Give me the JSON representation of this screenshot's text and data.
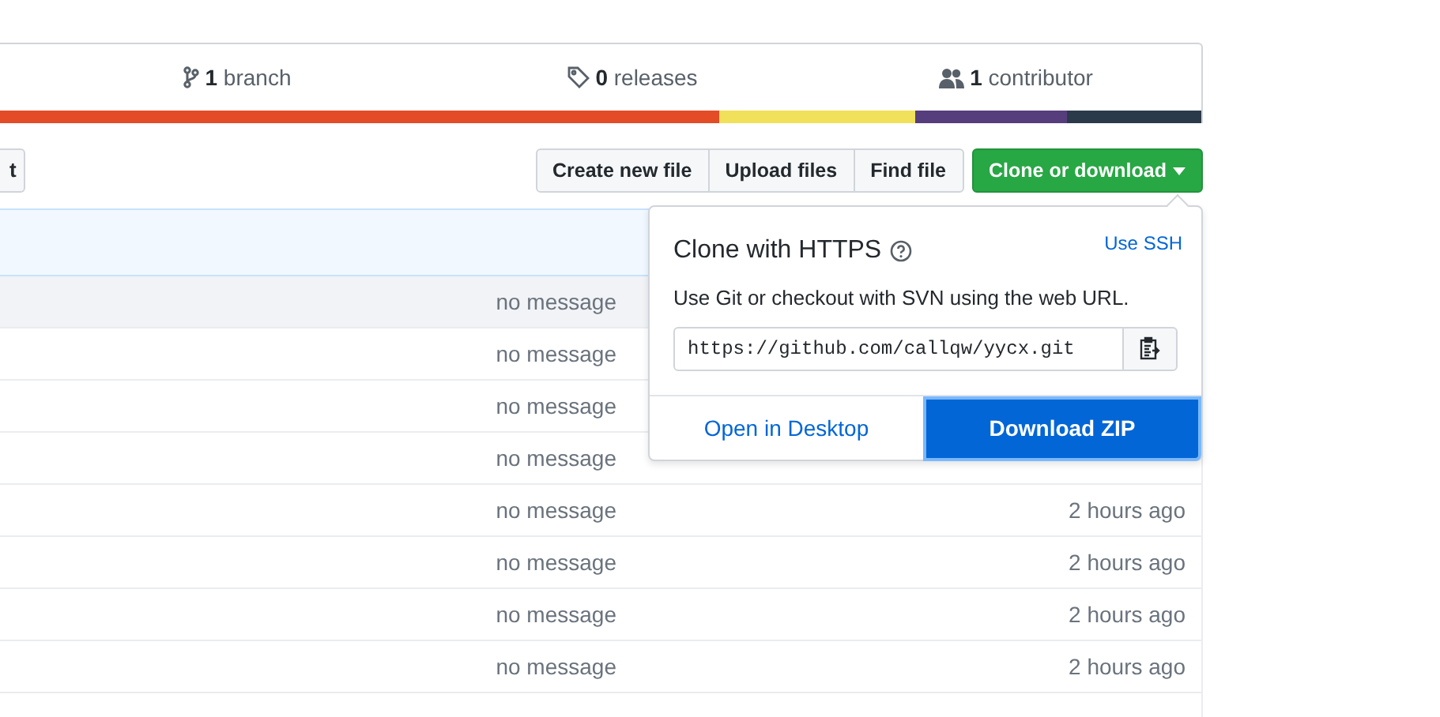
{
  "stats": [
    {
      "kind": "branch",
      "count": "1",
      "label": "branch"
    },
    {
      "kind": "releases",
      "count": "0",
      "label": "releases"
    },
    {
      "kind": "contributors",
      "count": "1",
      "label": "contributor"
    }
  ],
  "left_button": "t",
  "file_buttons": [
    "Create new file",
    "Upload files",
    "Find file"
  ],
  "clone_button": "Clone or download",
  "rows": [
    {
      "message": "no message",
      "selected": true
    },
    {
      "message": "no message",
      "selected": false
    },
    {
      "message": "no message",
      "selected": false
    },
    {
      "message": "no message",
      "selected": false
    },
    {
      "message": "no message",
      "time": "2 hours ago",
      "selected": false
    },
    {
      "message": "no message",
      "time": "2 hours ago",
      "selected": false
    },
    {
      "message": "no message",
      "time": "2 hours ago",
      "selected": false
    },
    {
      "message": "no message",
      "time": "2 hours ago",
      "selected": false
    }
  ],
  "clone_popover": {
    "title": "Clone with HTTPS",
    "switch_link": "Use SSH",
    "description": "Use Git or checkout with SVN using the web URL.",
    "url": "https://github.com/callqw/yycx.git",
    "open_desktop": "Open in Desktop",
    "download_zip": "Download ZIP"
  }
}
